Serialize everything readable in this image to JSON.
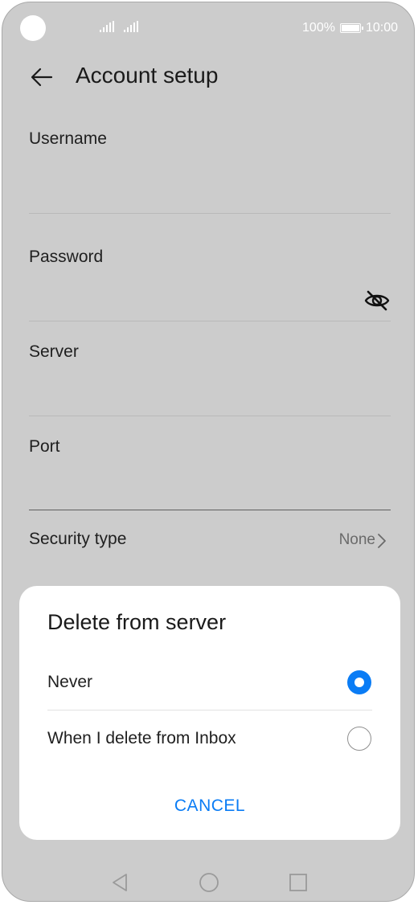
{
  "status_bar": {
    "battery_percent": "100%",
    "time": "10:00"
  },
  "header": {
    "title": "Account setup",
    "back_icon": "arrow-left-icon"
  },
  "form": {
    "fields": [
      {
        "label": "Username",
        "value": ""
      },
      {
        "label": "Password",
        "value": "",
        "icon": "eye-off-icon"
      },
      {
        "label": "Server",
        "value": ""
      },
      {
        "label": "Port",
        "value": ""
      }
    ],
    "security_type": {
      "label": "Security type",
      "value": "None"
    }
  },
  "dialog": {
    "title": "Delete from server",
    "options": [
      {
        "label": "Never",
        "selected": true
      },
      {
        "label": "When I delete from Inbox",
        "selected": false
      }
    ],
    "cancel_label": "CANCEL"
  },
  "colors": {
    "accent": "#0a7cf5",
    "scrim": "#cccccc"
  },
  "nav_bar": {
    "icons": [
      "back-triangle-icon",
      "home-circle-icon",
      "recents-square-icon"
    ]
  }
}
